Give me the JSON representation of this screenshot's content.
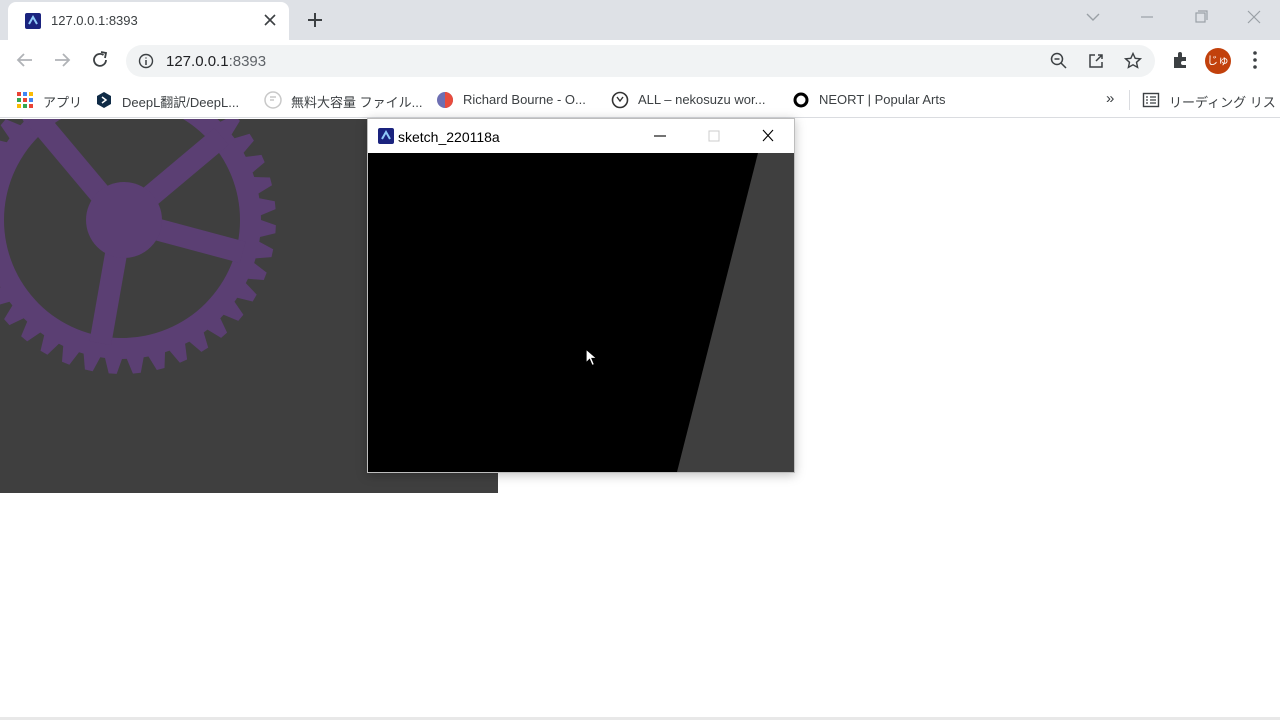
{
  "browser": {
    "tab": {
      "title": "127.0.0.1:8393"
    },
    "omnibox": {
      "host": "127.0.0.1",
      "rest": ":8393"
    },
    "avatar_text": "じゅ",
    "accent_color": "#c2410c"
  },
  "bookmarks": {
    "items": [
      {
        "label": "アプリ",
        "icon": "apps-grid-icon"
      },
      {
        "label": "DeepL翻訳/DeepL...",
        "icon": "deepl-icon"
      },
      {
        "label": "無料大容量 ファイル...",
        "icon": "file-service-icon"
      },
      {
        "label": "Richard Bourne - O...",
        "icon": "richard-bourne-icon"
      },
      {
        "label": "ALL – nekosuzu wor...",
        "icon": "nekosuzu-icon"
      },
      {
        "label": "NEORT | Popular Arts",
        "icon": "neort-icon"
      }
    ],
    "overflow": "»",
    "reading_list": "リーディング リスト"
  },
  "page": {
    "background_color": "#3f3f3f",
    "gear_color": "#5b3f73"
  },
  "sketch_window": {
    "title": "sketch_220118a",
    "canvas_color": "#000000",
    "shape_color": "#3f3f3f"
  }
}
